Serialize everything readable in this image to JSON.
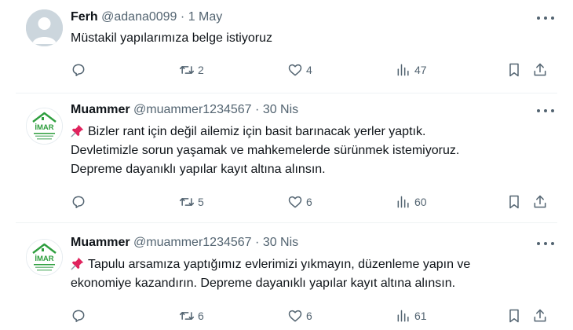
{
  "tweets": [
    {
      "name": "Ferh",
      "handle": "@adana0099",
      "separator": "·",
      "date": "1 May",
      "lines": [
        "Müstakil yapılarımıza belge istiyoruz"
      ],
      "counts": {
        "replies": "",
        "retweets": "2",
        "likes": "4",
        "views": "47"
      }
    },
    {
      "name": "Muammer",
      "handle": "@muammer1234567",
      "separator": "·",
      "date": "30 Nis",
      "avatar_text": "İMAR",
      "lines": [
        "Bizler rant için değil ailemiz için basit barınacak yerler yaptık.",
        "Devletimizle sorun yaşamak ve mahkemelerde sürünmek istemiyoruz.",
        "Depreme dayanıklı yapılar kayıt altına alınsın."
      ],
      "counts": {
        "replies": "",
        "retweets": "5",
        "likes": "6",
        "views": "60"
      }
    },
    {
      "name": "Muammer",
      "handle": "@muammer1234567",
      "separator": "·",
      "date": "30 Nis",
      "avatar_text": "İMAR",
      "lines": [
        "Tapulu arsamıza yaptığımız evlerimizi yıkmayın, düzenleme yapın ve",
        "ekonomiye kazandırın. Depreme dayanıklı yapılar kayıt altına alınsın."
      ],
      "counts": {
        "replies": "",
        "retweets": "6",
        "likes": "6",
        "views": "61"
      }
    }
  ],
  "icons": {
    "reply": "reply-icon",
    "retweet": "retweet-icon",
    "like": "like-icon",
    "views": "views-icon",
    "bookmark": "bookmark-icon",
    "share": "share-icon",
    "more": "more-icon",
    "pin": "pushpin-icon"
  },
  "colors": {
    "text": "#0f1419",
    "secondary": "#536471",
    "divider": "#eff3f4",
    "imar_green": "#2e9e3e",
    "pin_red": "#e0245e"
  }
}
